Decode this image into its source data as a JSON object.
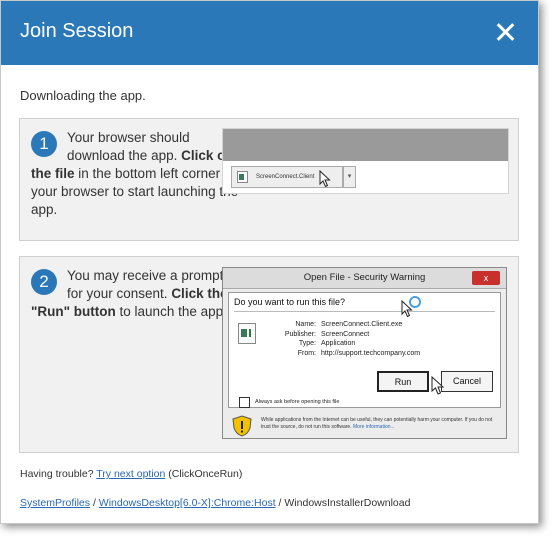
{
  "dialog": {
    "title": "Join Session",
    "intro": "Downloading the app."
  },
  "step1": {
    "number": "1",
    "text_a": "Your browser should download the app. ",
    "text_bold": "Click on the file",
    "text_b": " in the bottom left corner of your browser to start launching the app.",
    "image": {
      "file_label": "ScreenConnect.Client",
      "dropdown": "▾"
    }
  },
  "step2": {
    "number": "2",
    "text_a": "You may receive a prompt for your consent. ",
    "text_bold": "Click the \"Run\" button",
    "text_b": " to launch the app.",
    "image": {
      "window_title": "Open File - Security Warning",
      "close": "x",
      "question": "Do you want to run this file?",
      "fields": [
        {
          "k": "Name:",
          "v": "ScreenConnect.Client.exe"
        },
        {
          "k": "Publisher:",
          "v": "ScreenConnect"
        },
        {
          "k": "Type:",
          "v": "Application"
        },
        {
          "k": "From:",
          "v": "http://support.techcompany.com"
        }
      ],
      "run_label": "Run",
      "cancel_label": "Cancel",
      "checkbox_label": "Always ask before opening this file",
      "warning_text": "While applications from the Internet can be useful, they can potentially harm your computer. If you do not trust the source, do not run this software.",
      "more_info": "More information..."
    }
  },
  "footer": {
    "trouble_prefix": "Having trouble? ",
    "trouble_link": "Try next option",
    "trouble_suffix": " (ClickOnceRun)",
    "crumbs": [
      {
        "label": "SystemProfiles",
        "link": true
      },
      {
        "label": "WindowsDesktop[6.0-X]:Chrome:Host",
        "link": true
      },
      {
        "label": "WindowsInstallerDownload",
        "link": false
      }
    ],
    "separator": " / "
  }
}
